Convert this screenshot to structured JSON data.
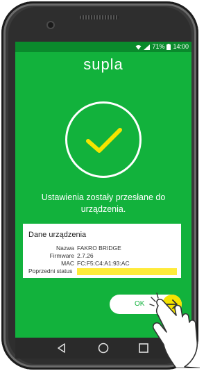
{
  "status_bar": {
    "battery_percent": "71%",
    "time": "14:00",
    "icons": [
      "wifi-icon",
      "signal-icon",
      "battery-icon"
    ]
  },
  "app": {
    "name": "supla",
    "brand_color": "#12b23c",
    "accent_color": "#f5e400"
  },
  "success": {
    "icon": "checkmark-icon",
    "message": "Ustawienia zostały przesłane do urządzenia."
  },
  "device_card": {
    "title": "Dane urządzenia",
    "rows": [
      {
        "label": "Nazwa",
        "value": "FAKRO BRIDGE"
      },
      {
        "label": "Firmware",
        "value": "2.7.26"
      },
      {
        "label": "MAC",
        "value": "FC:F5:C4:A1:93:AC"
      },
      {
        "label": "Poprzedni status",
        "value": ""
      }
    ]
  },
  "ok_button": {
    "label": "OK",
    "icon": "arrow-right-icon"
  },
  "nav": {
    "icons": [
      "back-icon",
      "home-icon",
      "recents-icon"
    ]
  }
}
